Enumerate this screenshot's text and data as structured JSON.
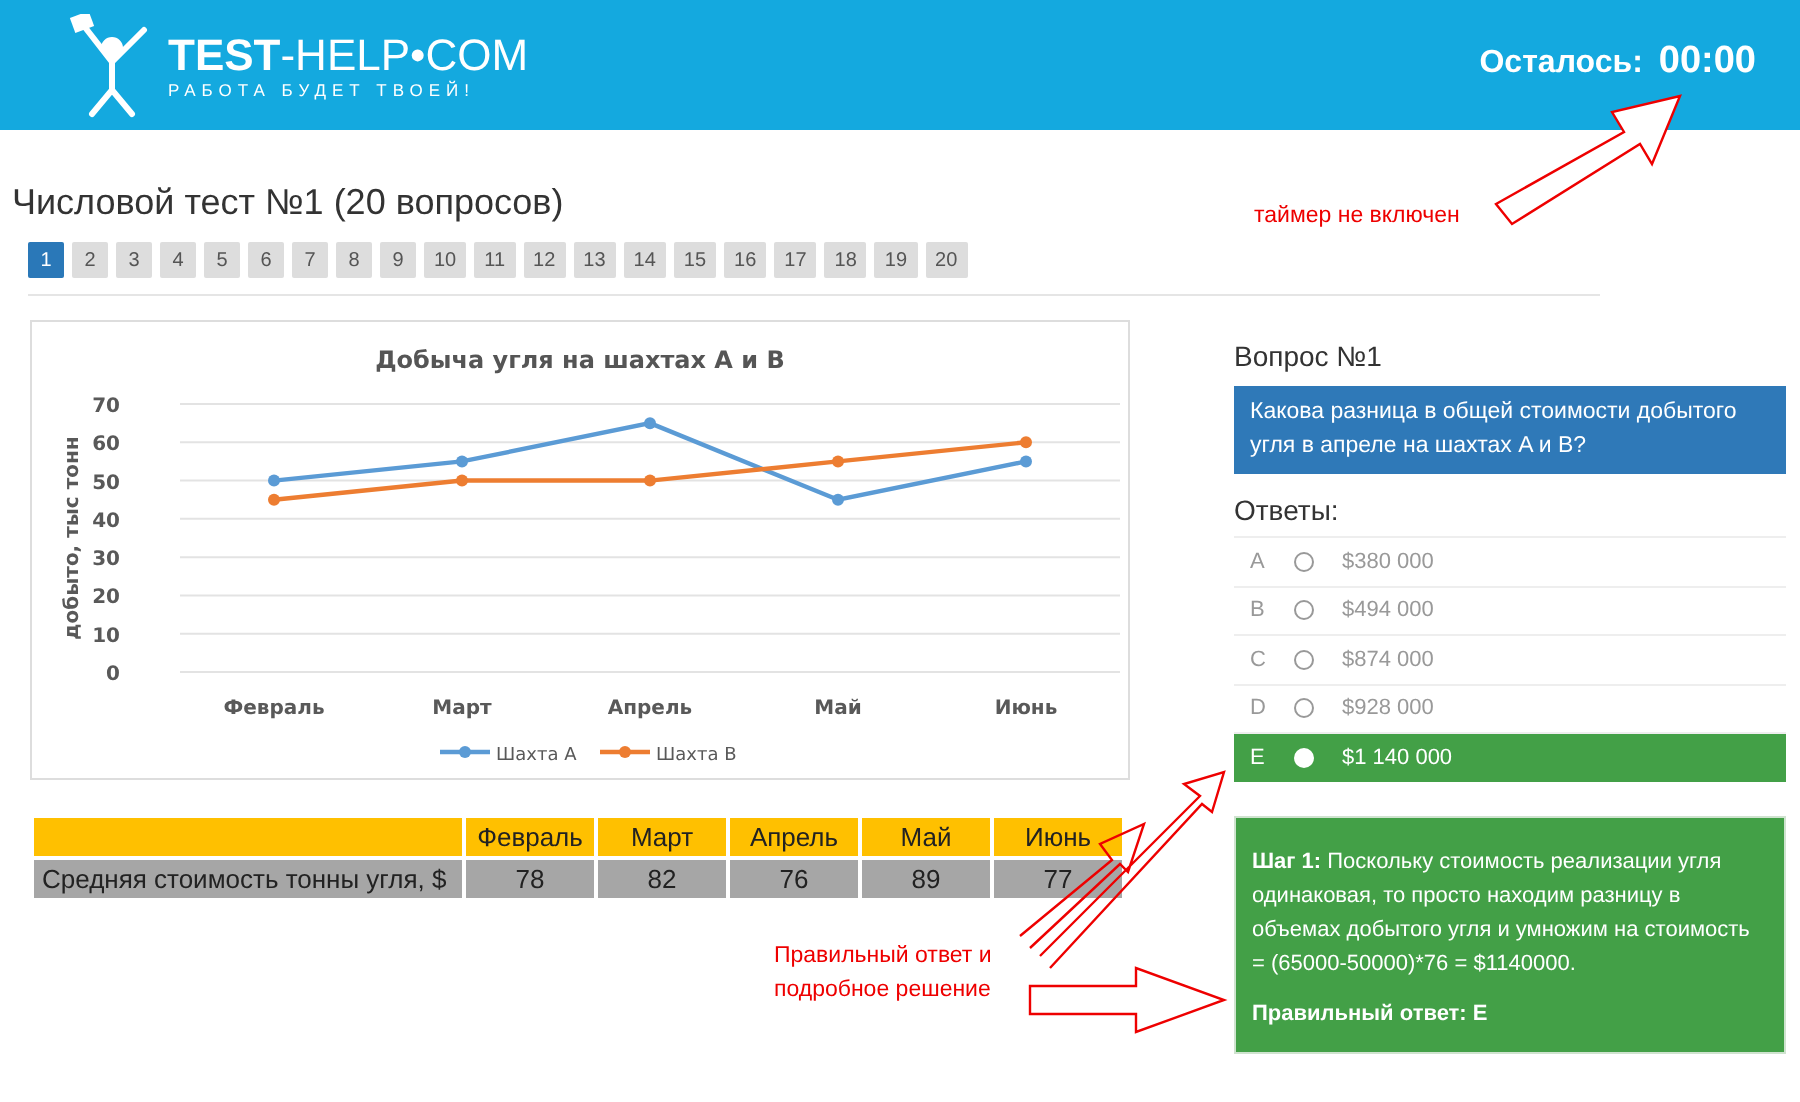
{
  "header": {
    "logo_title": "**TEST**-HELP•COM",
    "logo_tagline": "РАБОТА БУДЕТ ТВОЕЙ!",
    "timer_label": "Осталось:",
    "timer_value": "00:00"
  },
  "test_title": "Числовой тест №1 (20 вопросов)",
  "pager": [
    {
      "label": "1",
      "selected": true
    },
    {
      "label": "2",
      "selected": false
    },
    {
      "label": "3",
      "selected": false
    },
    {
      "label": "4",
      "selected": false
    },
    {
      "label": "5",
      "selected": false
    },
    {
      "label": "6",
      "selected": false
    },
    {
      "label": "7",
      "selected": false
    },
    {
      "label": "8",
      "selected": false
    },
    {
      "label": "9",
      "selected": false
    },
    {
      "label": "10",
      "selected": false
    },
    {
      "label": "11",
      "selected": false
    },
    {
      "label": "12",
      "selected": false
    },
    {
      "label": "13",
      "selected": false
    },
    {
      "label": "14",
      "selected": false
    },
    {
      "label": "15",
      "selected": false
    },
    {
      "label": "16",
      "selected": false
    },
    {
      "label": "17",
      "selected": false
    },
    {
      "label": "18",
      "selected": false
    },
    {
      "label": "19",
      "selected": false
    },
    {
      "label": "20",
      "selected": false
    }
  ],
  "chart_data": {
    "type": "line",
    "title": "Добыча угля на шахтах A и B",
    "ylabel": "добыто,  тыс тонн",
    "categories": [
      "Февраль",
      "Март",
      "Апрель",
      "Май",
      "Июнь"
    ],
    "ylim": [
      0,
      70
    ],
    "grid": true,
    "legend": true,
    "yticks": [
      0,
      10,
      20,
      30,
      40,
      50,
      60,
      70
    ],
    "series": [
      {
        "name": "Шахта A",
        "color": "#5b9bd5",
        "marker": "circle",
        "values": [
          50,
          55,
          65,
          45,
          55
        ]
      },
      {
        "name": "Шахта B",
        "color": "#ed7d31",
        "marker": "circle",
        "values": [
          45,
          50,
          50,
          55,
          60
        ]
      }
    ]
  },
  "price_table": {
    "columns": [
      "Февраль",
      "Март",
      "Апрель",
      "Май",
      "Июнь"
    ],
    "row_label": "Средняя стоимость тонны угля, $",
    "values": [
      "78",
      "82",
      "76",
      "89",
      "77"
    ]
  },
  "question": {
    "heading": "Вопрос №1",
    "text": "Какова разница в общей стоимости добытого угля в апреле на шахтах A и B?",
    "answers_heading": "Ответы:",
    "answers": [
      {
        "letter": "A",
        "text": "$380 000",
        "selected": false
      },
      {
        "letter": "B",
        "text": "$494 000",
        "selected": false
      },
      {
        "letter": "C",
        "text": "$874 000",
        "selected": false
      },
      {
        "letter": "D",
        "text": "$928 000",
        "selected": false
      },
      {
        "letter": "E",
        "text": "$1 140 000",
        "selected": true
      }
    ]
  },
  "solution": {
    "text": "**Шаг 1:** Поскольку стоимость реализации угля одинаковая, то просто находим разницу в объемах добытого угля и умножим на стоимость = (65000-50000)*76 = $1140000.",
    "answer": "Правильный ответ: E"
  },
  "annotations": {
    "timer_note": "таймер не включен",
    "answer_note": "Правильный ответ и подробное решение"
  }
}
